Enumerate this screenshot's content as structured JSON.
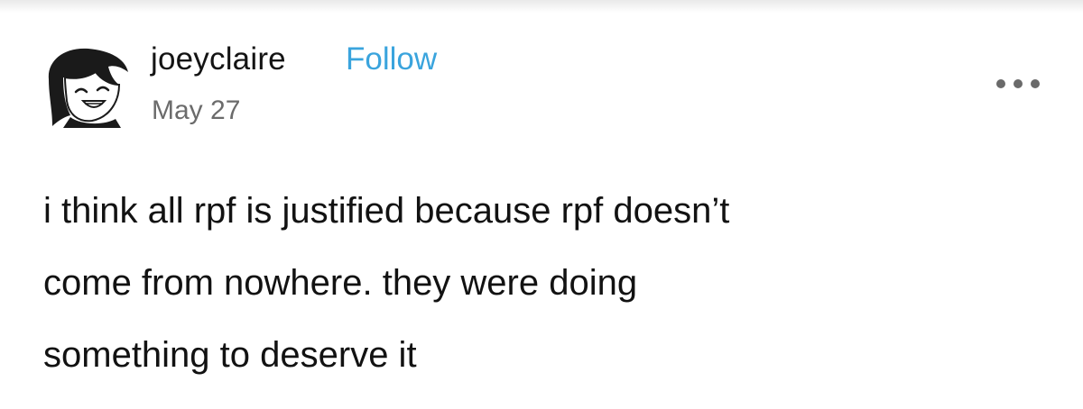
{
  "post": {
    "author": {
      "username": "joeyclaire",
      "follow_label": "Follow",
      "date": "May 27"
    },
    "menu_icon": "more-options-icon",
    "body_lines": [
      "i think all rpf is justified because rpf doesn’t",
      "come from nowhere. they were doing",
      "something to deserve it"
    ]
  },
  "colors": {
    "follow": "#3aa4dd",
    "username": "#141414",
    "date": "#6b6b6b",
    "body": "#121212",
    "menu_dots": "#6a6a6a"
  }
}
